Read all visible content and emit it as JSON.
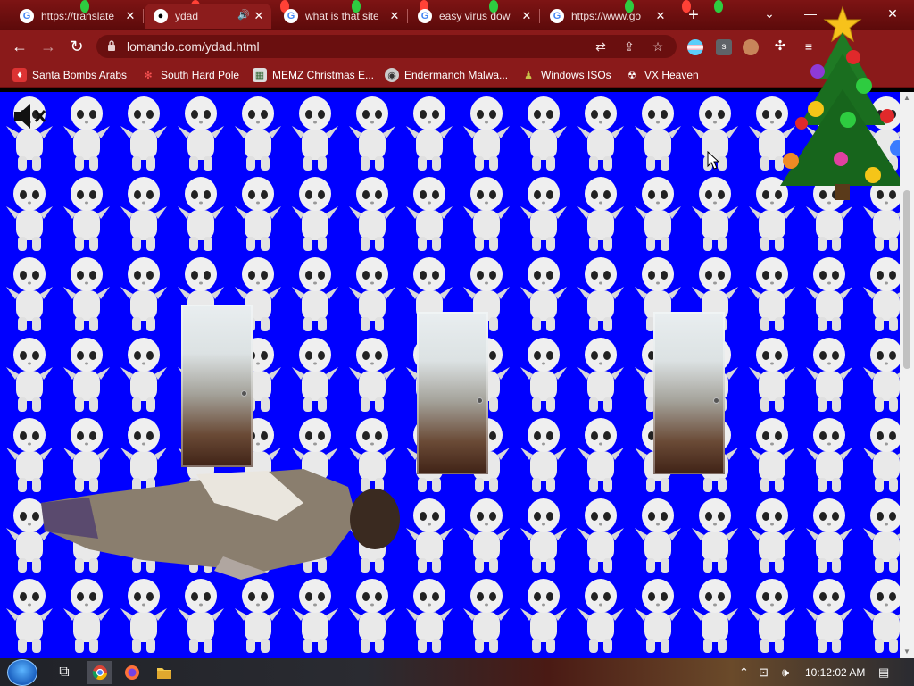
{
  "tabs": [
    {
      "title": "https://translate",
      "favicon": "google-icon",
      "active": false
    },
    {
      "title": "ydad",
      "favicon": "panda-icon",
      "active": true,
      "audio": true
    },
    {
      "title": "what is that site",
      "favicon": "google-icon",
      "active": false
    },
    {
      "title": "easy virus dow",
      "favicon": "google-icon",
      "active": false
    },
    {
      "title": "https://www.go",
      "favicon": "google-icon",
      "active": false
    }
  ],
  "address_bar": {
    "url": "lomando.com/ydad.html"
  },
  "bookmarks": [
    {
      "label": "Santa Bombs Arabs",
      "icon": "santa-icon"
    },
    {
      "label": "South Hard Pole",
      "icon": "snowflake-icon"
    },
    {
      "label": "MEMZ Christmas E...",
      "icon": "memz-icon"
    },
    {
      "label": "Endermanch Malwa...",
      "icon": "enderman-icon"
    },
    {
      "label": "Windows ISOs",
      "icon": "windows-icon"
    },
    {
      "label": "VX Heaven",
      "icon": "vx-icon"
    }
  ],
  "page": {
    "background": "#0000ff",
    "door_count": 3
  },
  "taskbar": {
    "clock": "10:12:02 AM"
  },
  "colors": {
    "chrome_theme": "#8a1a1a",
    "page_bg": "#0000ff"
  }
}
